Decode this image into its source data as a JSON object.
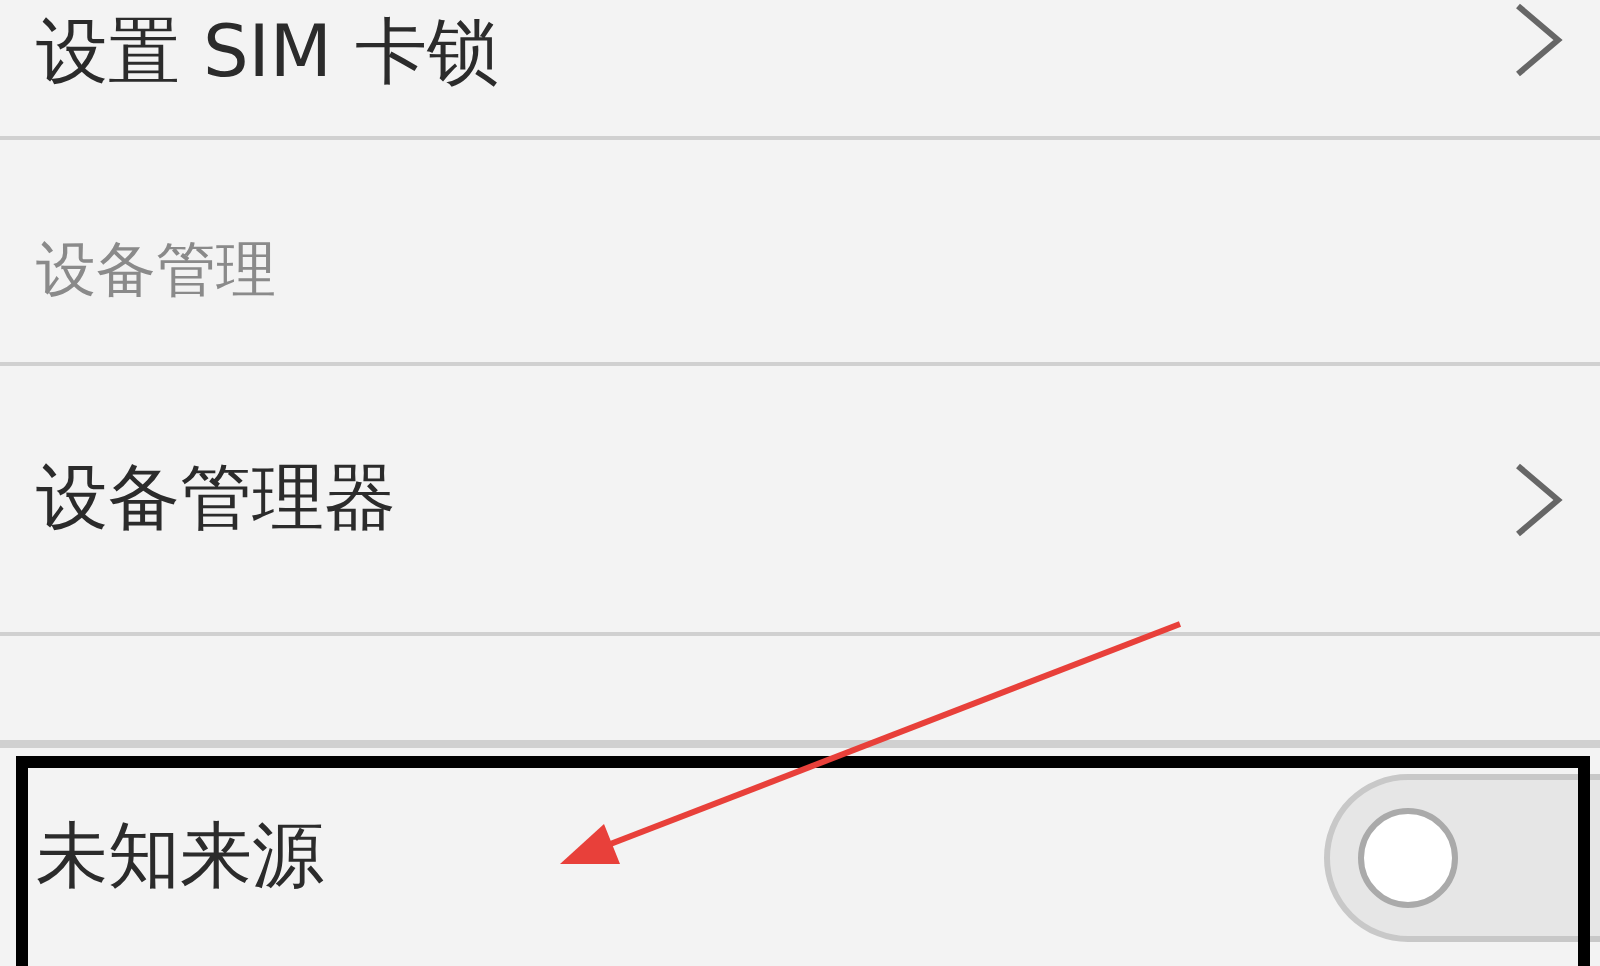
{
  "rows": [
    {
      "kind": "link",
      "label": "设置 SIM 卡锁"
    },
    {
      "kind": "header",
      "label": "设备管理"
    },
    {
      "kind": "link",
      "label": "设备管理器"
    },
    {
      "kind": "spacer"
    },
    {
      "kind": "toggle",
      "label": "未知来源",
      "on": false
    }
  ],
  "annotations": [
    {
      "kind": "box"
    },
    {
      "kind": "arrow"
    }
  ]
}
